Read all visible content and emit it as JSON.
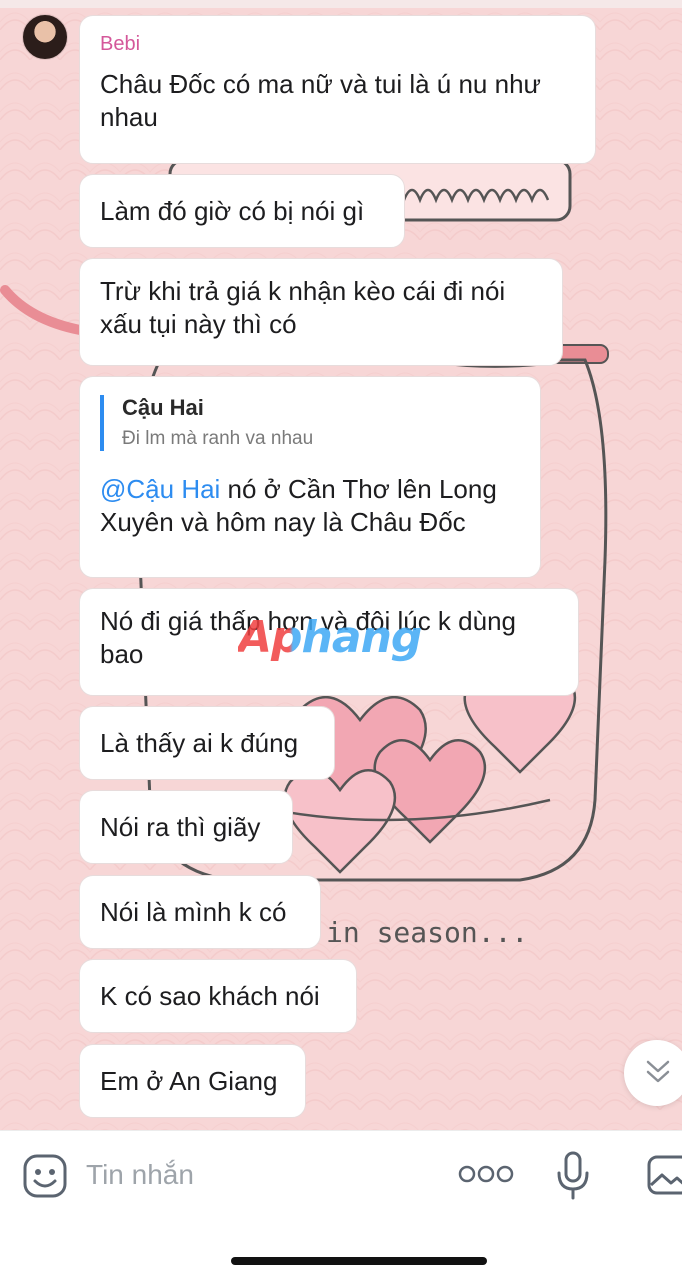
{
  "chat": {
    "sender_name": "Bebi",
    "messages": [
      "Châu Đốc có ma nữ và tui là ú nu như nhau",
      "Làm đó giờ có bị nói gì",
      "Trừ khi trả giá k nhận kèo cái đi nói xấu tụi này thì có",
      "",
      "Nó đi giá thấp hơn và đôi lúc k dùng bao",
      "Là thấy ai k đúng",
      "Nói ra thì giãy",
      "Nói là mình k có",
      "K có sao khách nói",
      "Em ở An Giang"
    ],
    "reply": {
      "quoted_name": "Cậu Hai",
      "quoted_text": "Đi lm mà ranh va nhau",
      "mention": "@Cậu Hai",
      "text": " nó ở Cần Thơ lên Long Xuyên và hôm nay là Châu Đốc"
    }
  },
  "background": {
    "caption": "in season..."
  },
  "watermark": "Aphang",
  "composer": {
    "placeholder": "Tin nhắn"
  },
  "icons": {
    "emoji": "emoji-icon",
    "more": "more-icon",
    "mic": "mic-icon",
    "image": "image-icon",
    "scroll": "chevron-double-down-icon"
  },
  "colors": {
    "background": "#f7d6d6",
    "sender": "#d4579a",
    "mention": "#2d8cf0",
    "bubble": "#ffffff"
  }
}
